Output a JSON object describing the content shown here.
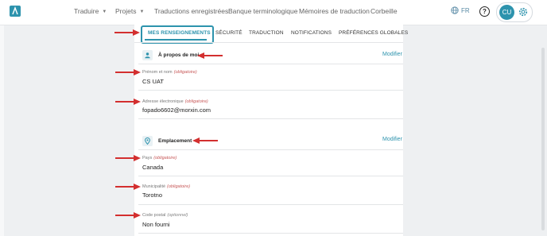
{
  "nav": {
    "items": [
      {
        "label": "Traduire",
        "dropdown": true
      },
      {
        "label": "Projets",
        "dropdown": true
      },
      {
        "label": "Traductions enregistrées",
        "dropdown": false
      },
      {
        "label": "Banque terminologique",
        "dropdown": false
      },
      {
        "label": "Mémoires de traduction",
        "dropdown": false
      },
      {
        "label": "Corbeille",
        "dropdown": false
      }
    ],
    "language": "FR",
    "help_icon": "question-circle-icon",
    "user_initials": "CU",
    "settings_icon": "gear-icon"
  },
  "tabs": [
    {
      "label": "MES RENSEIGNEMENTS",
      "active": true
    },
    {
      "label": "SÉCURITÉ",
      "active": false
    },
    {
      "label": "TRADUCTION",
      "active": false
    },
    {
      "label": "NOTIFICATIONS",
      "active": false
    },
    {
      "label": "PRÉFÉRENCES GLOBALES",
      "active": false
    }
  ],
  "sections": [
    {
      "title": "À propos de moi",
      "icon": "person-icon",
      "modify_label": "Modifier",
      "fields": [
        {
          "label": "Prénom et nom",
          "qualifier": "(obligatoire)",
          "value": "CS UAT"
        },
        {
          "label": "Adresse électronique",
          "qualifier": "(obligatoire)",
          "value": "fopado6602@morxin.com"
        }
      ]
    },
    {
      "title": "Emplacement",
      "icon": "location-pin-icon",
      "modify_label": "Modifier",
      "fields": [
        {
          "label": "Pays",
          "qualifier": "(obligatoire)",
          "value": "Canada"
        },
        {
          "label": "Municipalité",
          "qualifier": "(obligatoire)",
          "value": "Torotno"
        },
        {
          "label": "Code postal",
          "qualifier": "(optionnel)",
          "value": "Non fourni"
        }
      ]
    }
  ],
  "colors": {
    "accent": "#2d93ad",
    "annotation_arrow": "#d32f2f",
    "required": "#c85a5a"
  }
}
